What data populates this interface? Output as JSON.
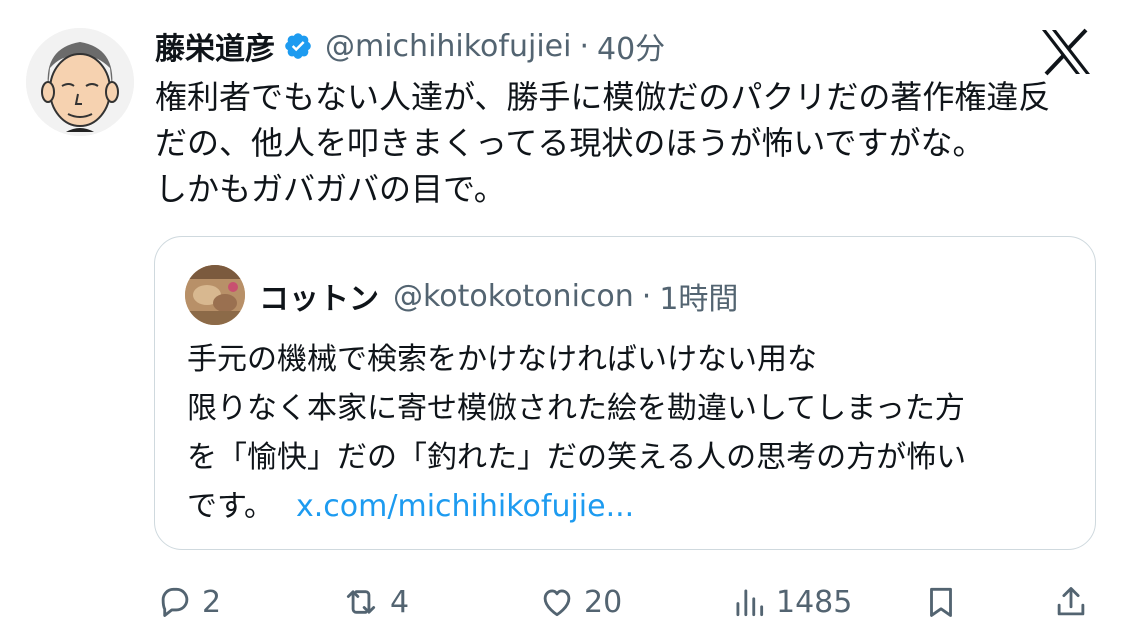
{
  "tweet": {
    "author_name": "藤栄道彦",
    "handle": "@michihikofujiei",
    "separator": "·",
    "time": "40分",
    "text_lines": [
      "権利者でもない人達が、勝手に模倣だのパクリだの著作権違反",
      "だの、他人を叩きまくってる現状のほうが怖いですがな。",
      "しかもガバガバの目で。"
    ]
  },
  "quoted": {
    "author_name": "コットン",
    "handle": "@kotokotonicon",
    "separator": "·",
    "time": "1時間",
    "text_lines": [
      "手元の機械で検索をかけなければいけない用な",
      "限りなく本家に寄せ模倣された絵を勘違いしてしまった方",
      "を「愉快」だの「釣れた」だの笑える人の思考の方が怖い"
    ],
    "last_line_text": "です。",
    "link_text": "x.com/michihikofujie..."
  },
  "actions": {
    "replies": "2",
    "reposts": "4",
    "likes": "20",
    "views": "1485"
  },
  "icons": {
    "verified": "verified-badge-icon",
    "platform": "x-logo-icon",
    "reply": "reply-icon",
    "repost": "repost-icon",
    "like": "heart-icon",
    "views": "views-icon",
    "bookmark": "bookmark-icon",
    "share": "share-icon"
  },
  "colors": {
    "text": "#0f1419",
    "secondary": "#536471",
    "link": "#1d9bf0",
    "verified": "#1d9bf0",
    "border": "#cfd9de"
  }
}
